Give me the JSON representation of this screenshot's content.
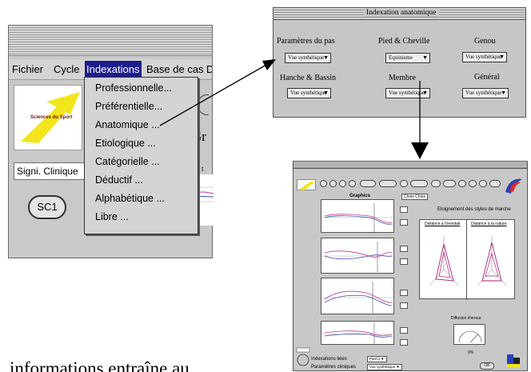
{
  "left_window": {
    "menubar": [
      "Fichier",
      "Cycle",
      "Indexations",
      "Base de cas",
      "D"
    ],
    "logo_text": "Sciences du Sport",
    "clinique_field": "Signi. Clinique",
    "sc1_button": "SC1",
    "behind_text": "Gr",
    "behind_small": "da t"
  },
  "dropdown": {
    "items": [
      "Professionnelle...",
      "Préférentielle...",
      "Anatomique ...",
      "Etiologique ...",
      "Catégorielle ...",
      "Déductif ...",
      "Alphabétique ...",
      "Libre ..."
    ]
  },
  "indexation_window": {
    "title": "Indexation anatomique",
    "fields": [
      {
        "label": "Paramètres du pas",
        "value": "Vue synthétique"
      },
      {
        "label": "Pied & Cheville",
        "value": "Equinisme"
      },
      {
        "label": "Genou",
        "value": "Vue synthétique"
      },
      {
        "label": "Hanche & Bassin",
        "value": "Vue synthétique"
      },
      {
        "label": "Membre",
        "value": "Vue synthétique"
      },
      {
        "label": "Général",
        "value": "Vue synthétique"
      }
    ]
  },
  "big_window": {
    "graphics_label": "Graphics",
    "choix_label": "Choix Choix",
    "eloignement_title": "Eloignement des styles de marche",
    "radar_left_header": "Distance à l'éventail",
    "radar_right_header": "Distance à la nature",
    "gauge_label": "Diffusion d'erreur",
    "percent": "0%",
    "indexations_label": "Indexations liées",
    "indexations_value": "Pied d",
    "params_label": "Paramètres cliniques",
    "params_value": "Vue synthétique",
    "ok_label": "OK"
  },
  "caption": "informations entraîne au",
  "colors": {
    "menu_highlight": "#1d1d8e",
    "window_bg": "#c9c9c9",
    "radar_line": "#aa1f7a"
  }
}
